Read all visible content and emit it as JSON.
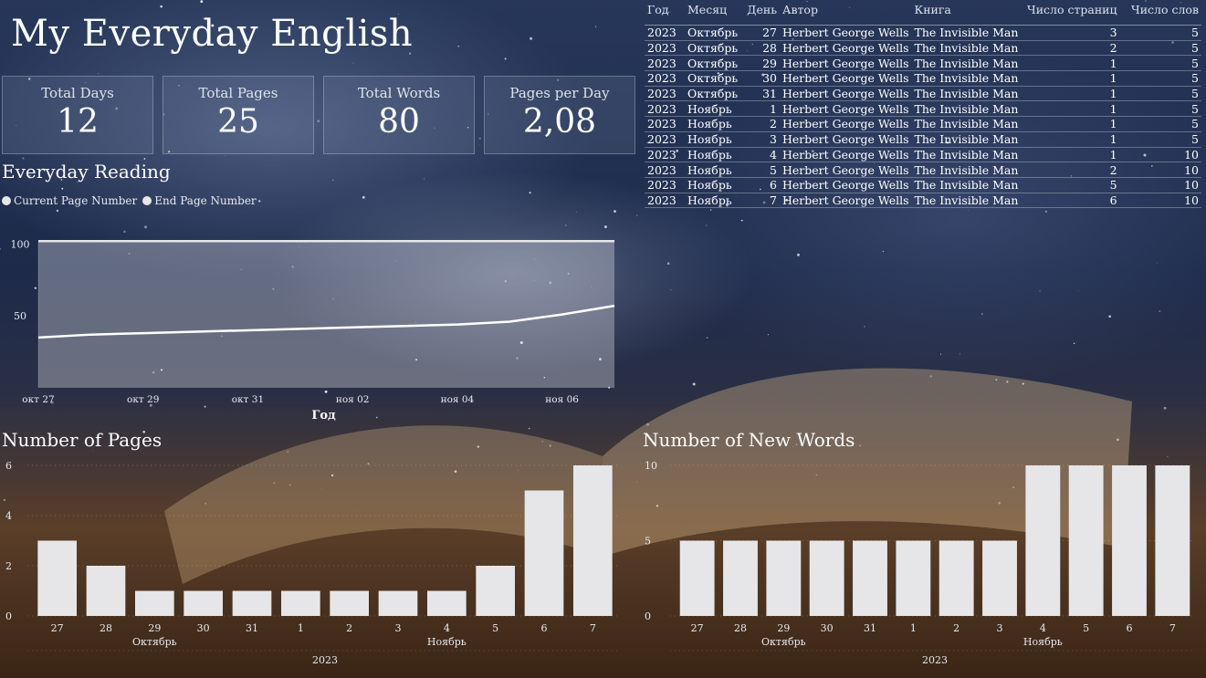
{
  "title": "My Everyday English",
  "kpis": [
    {
      "label": "Total Days",
      "value": "12"
    },
    {
      "label": "Total Pages",
      "value": "25"
    },
    {
      "label": "Total Words",
      "value": "80"
    },
    {
      "label": "Pages per Day",
      "value": "2,08"
    }
  ],
  "reading": {
    "title": "Everyday Reading",
    "legend": [
      "Current Page Number",
      "End Page Number"
    ]
  },
  "table": {
    "headers": [
      "Год",
      "Месяц",
      "День",
      "Автор",
      "Книга",
      "Число страниц",
      "Число слов"
    ],
    "rows": [
      [
        "2023",
        "Октябрь",
        "27",
        "Herbert George Wells",
        "The Invisible Man",
        "3",
        "5"
      ],
      [
        "2023",
        "Октябрь",
        "28",
        "Herbert George Wells",
        "The Invisible Man",
        "2",
        "5"
      ],
      [
        "2023",
        "Октябрь",
        "29",
        "Herbert George Wells",
        "The Invisible Man",
        "1",
        "5"
      ],
      [
        "2023",
        "Октябрь",
        "30",
        "Herbert George Wells",
        "The Invisible Man",
        "1",
        "5"
      ],
      [
        "2023",
        "Октябрь",
        "31",
        "Herbert George Wells",
        "The Invisible Man",
        "1",
        "5"
      ],
      [
        "2023",
        "Ноябрь",
        "1",
        "Herbert George Wells",
        "The Invisible Man",
        "1",
        "5"
      ],
      [
        "2023",
        "Ноябрь",
        "2",
        "Herbert George Wells",
        "The Invisible Man",
        "1",
        "5"
      ],
      [
        "2023",
        "Ноябрь",
        "3",
        "Herbert George Wells",
        "The Invisible Man",
        "1",
        "5"
      ],
      [
        "2023",
        "Ноябрь",
        "4",
        "Herbert George Wells",
        "The Invisible Man",
        "1",
        "10"
      ],
      [
        "2023",
        "Ноябрь",
        "5",
        "Herbert George Wells",
        "The Invisible Man",
        "2",
        "10"
      ],
      [
        "2023",
        "Ноябрь",
        "6",
        "Herbert George Wells",
        "The Invisible Man",
        "5",
        "10"
      ],
      [
        "2023",
        "Ноябрь",
        "7",
        "Herbert George Wells",
        "The Invisible Man",
        "6",
        "10"
      ]
    ]
  },
  "chart_data": [
    {
      "type": "area",
      "title": "Everyday Reading",
      "xlabel": "Год",
      "x_ticks": [
        "окт 27",
        "окт 29",
        "окт 31",
        "ноя 02",
        "ноя 04",
        "ноя 06"
      ],
      "y_ticks": [
        "50",
        "100"
      ],
      "ylim": [
        0,
        100
      ],
      "x": [
        "окт 27",
        "окт 28",
        "окт 29",
        "окт 30",
        "окт 31",
        "ноя 01",
        "ноя 02",
        "ноя 03",
        "ноя 04",
        "ноя 05",
        "ноя 06",
        "ноя 07"
      ],
      "series": [
        {
          "name": "Current Page Number",
          "values": [
            35,
            37,
            38,
            39,
            40,
            41,
            42,
            43,
            44,
            46,
            51,
            57
          ]
        },
        {
          "name": "End Page Number",
          "values": [
            102,
            102,
            102,
            102,
            102,
            102,
            102,
            102,
            102,
            102,
            102,
            102
          ]
        }
      ],
      "legend": "top-left",
      "colors": {
        "line": "#ffffff",
        "area": "#e6e6ea"
      }
    },
    {
      "type": "bar",
      "title": "Number of Pages",
      "categories": [
        "27",
        "28",
        "29",
        "30",
        "31",
        "1",
        "2",
        "3",
        "4",
        "5",
        "6",
        "7"
      ],
      "month_labels": [
        "Октябрь",
        "Ноябрь"
      ],
      "month_spans": [
        5,
        7
      ],
      "year_label": "2023",
      "values": [
        3,
        2,
        1,
        1,
        1,
        1,
        1,
        1,
        1,
        2,
        5,
        6
      ],
      "y_ticks": [
        "0",
        "2",
        "4",
        "6"
      ],
      "ylim": [
        0,
        6
      ],
      "colors": {
        "bar": "#e6e6e9"
      }
    },
    {
      "type": "bar",
      "title": "Number of New Words",
      "categories": [
        "27",
        "28",
        "29",
        "30",
        "31",
        "1",
        "2",
        "3",
        "4",
        "5",
        "6",
        "7"
      ],
      "month_labels": [
        "Октябрь",
        "Ноябрь"
      ],
      "month_spans": [
        5,
        7
      ],
      "year_label": "2023",
      "values": [
        5,
        5,
        5,
        5,
        5,
        5,
        5,
        5,
        10,
        10,
        10,
        10
      ],
      "y_ticks": [
        "0",
        "5",
        "10"
      ],
      "ylim": [
        0,
        10
      ],
      "colors": {
        "bar": "#e6e6e9"
      }
    }
  ]
}
